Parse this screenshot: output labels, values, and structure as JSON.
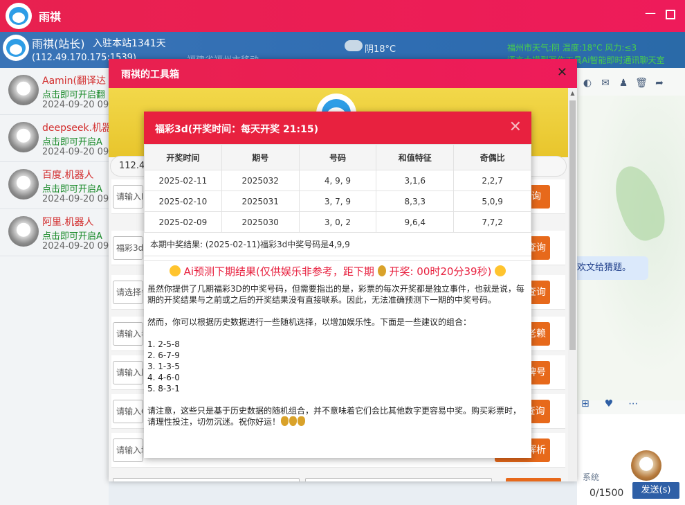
{
  "app": {
    "title": "雨祺"
  },
  "user": {
    "name": "雨祺(站长)",
    "days": "入驻本站1341天",
    "ip": "(112.49.170.175:1539)",
    "location": "福建省福州市移动",
    "weather": "阴18°C",
    "weather_right": "福州市天气:阴 温度:18°C 风力:≤3",
    "ticker": "语言大模型写作工具Ai智能即时通讯聊天室"
  },
  "contacts": [
    {
      "name": "Aamin(翻译达",
      "sub": "点击即可开启翻",
      "time": "2024-09-20 09"
    },
    {
      "name": "deepseek.机器",
      "sub": "点击即可开启A",
      "time": "2024-09-20 09"
    },
    {
      "name": "百度.机器人",
      "sub": "点击即可开启A",
      "time": "2024-09-20 09"
    },
    {
      "name": "阿里.机器人",
      "sub": "点击即可开启A",
      "time": "2024-09-20 09"
    }
  ],
  "chat": {
    "bubble": "欢文给猜题。",
    "counter": "0/1500",
    "send_label": "发送(s)",
    "label": "系统"
  },
  "toolbox": {
    "title": "雨祺的工具箱",
    "ip_text": "112.49",
    "rows": [
      {
        "field": "请输入IP",
        "button": "查询"
      },
      {
        "field": "福彩3d",
        "button": "速查询"
      },
      {
        "field": "请选择省",
        "button": "气查询"
      },
      {
        "field": "请输入老",
        "button": "印老赖"
      },
      {
        "field": "请输入股",
        "button": "车牌号"
      },
      {
        "field": "请输入Q",
        "button": "Q查询"
      },
      {
        "field": "请输入域",
        "button": "频解析"
      }
    ]
  },
  "lottery": {
    "title": "福彩3d(开奖时间：每天开奖 21:15)",
    "headers": [
      "开奖时间",
      "期号",
      "号码",
      "和值特征",
      "奇偶比"
    ],
    "rows": [
      [
        "2025-02-11",
        "2025032",
        "4, 9, 9",
        "3,1,6",
        "2,2,7"
      ],
      [
        "2025-02-10",
        "2025031",
        "3, 7, 9",
        "8,3,3",
        "5,0,9"
      ],
      [
        "2025-02-09",
        "2025030",
        "3, 0, 2",
        "9,6,4",
        "7,7,2"
      ]
    ],
    "result": "本期中奖结果: (2025-02-11)福彩3d中奖号码是4,9,9",
    "predict_title": "Ai预测下期结果(仅供娱乐非参考，距下期",
    "predict_countdown": "开奖: 00时20分39秒)",
    "para1": "虽然你提供了几期福彩3D的中奖号码，但需要指出的是，彩票的每次开奖都是独立事件，也就是说，每期的开奖结果与之前或之后的开奖结果没有直接联系。因此，无法准确预测下一期的中奖号码。",
    "para2": "然而，你可以根据历史数据进行一些随机选择，以增加娱乐性。下面是一些建议的组合：",
    "combos": [
      "1. 2-5-8",
      "2. 6-7-9",
      "3. 1-3-5",
      "4. 4-6-0",
      "5. 8-3-1"
    ],
    "para3": "请注意，这些只是基于历史数据的随机组合，并不意味着它们会比其他数字更容易中奖。购买彩票时，请理性投注，切勿沉迷。祝你好运！"
  }
}
